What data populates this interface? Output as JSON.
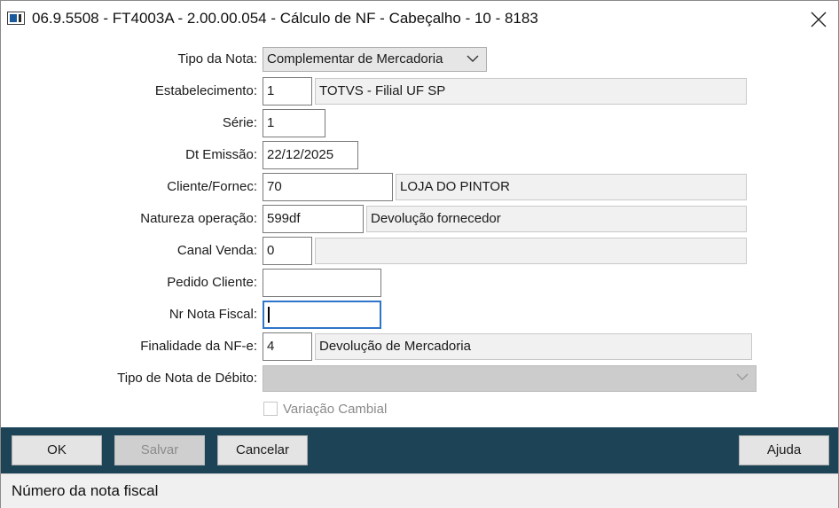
{
  "window": {
    "title": "06.9.5508 - FT4003A - 2.00.00.054 - Cálculo de NF - Cabeçalho - 10 - 8183",
    "app_icon": "window-app-icon",
    "close_icon": "close-icon"
  },
  "form": {
    "tipo_nota": {
      "label": "Tipo da Nota:",
      "value": "Complementar de Mercadoria"
    },
    "estabelecimento": {
      "label": "Estabelecimento:",
      "code": "1",
      "description": "TOTVS - Filial UF SP"
    },
    "serie": {
      "label": "Série:",
      "value": "1"
    },
    "dt_emissao": {
      "label": "Dt Emissão:",
      "value": "22/12/2025"
    },
    "cliente_fornec": {
      "label": "Cliente/Fornec:",
      "code": "70",
      "description": "LOJA DO PINTOR"
    },
    "natureza_operacao": {
      "label": "Natureza operação:",
      "code": "599df",
      "description": "Devolução fornecedor"
    },
    "canal_venda": {
      "label": "Canal Venda:",
      "code": "0",
      "description": ""
    },
    "pedido_cliente": {
      "label": "Pedido Cliente:",
      "value": ""
    },
    "nr_nota_fiscal": {
      "label": "Nr Nota Fiscal:",
      "value": ""
    },
    "finalidade_nfe": {
      "label": "Finalidade da NF-e:",
      "code": "4",
      "description": "Devolução de Mercadoria"
    },
    "tipo_nota_debito": {
      "label": "Tipo de Nota de Débito:",
      "value": ""
    },
    "variacao_cambial": {
      "label": "Variação Cambial",
      "checked": false
    }
  },
  "buttons": {
    "ok": "OK",
    "salvar": "Salvar",
    "cancelar": "Cancelar",
    "ajuda": "Ajuda"
  },
  "status": {
    "text": "Número da nota fiscal"
  },
  "colors": {
    "button_bar": "#1c4356",
    "focus": "#2f74c9"
  }
}
